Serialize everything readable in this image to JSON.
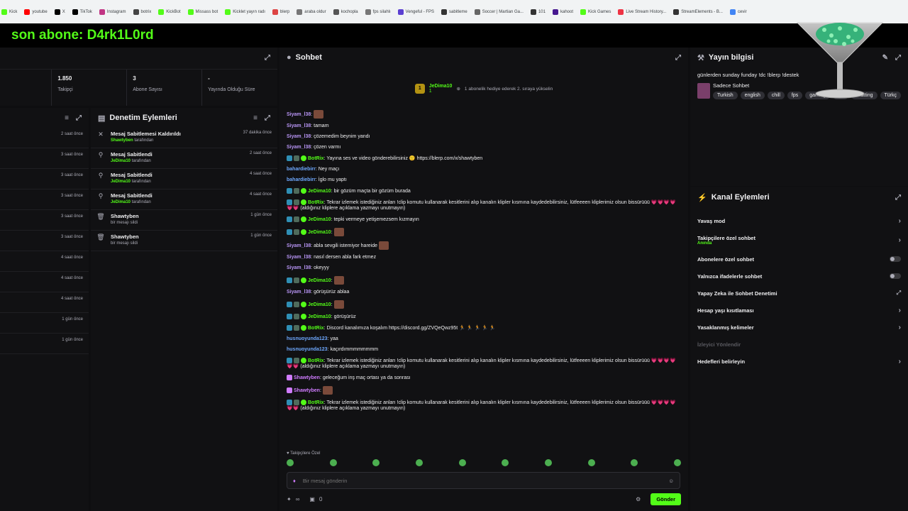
{
  "bookmarks": [
    {
      "label": "Kick",
      "color": "#53fc18"
    },
    {
      "label": "youtube",
      "color": "#ff0000"
    },
    {
      "label": "X",
      "color": "#000000"
    },
    {
      "label": "TikTok",
      "color": "#010101"
    },
    {
      "label": "Instagram",
      "color": "#c13584"
    },
    {
      "label": "botrix",
      "color": "#444444"
    },
    {
      "label": "KickBot",
      "color": "#53fc18"
    },
    {
      "label": "Missass bot",
      "color": "#53fc18"
    },
    {
      "label": "Kicklet yayın radı",
      "color": "#53fc18"
    },
    {
      "label": "blerp",
      "color": "#d44"
    },
    {
      "label": "araba oldur",
      "color": "#777"
    },
    {
      "label": "kochopla",
      "color": "#555"
    },
    {
      "label": "fps silahlı",
      "color": "#777"
    },
    {
      "label": "Vengeful - FPS",
      "color": "#5b3fd1"
    },
    {
      "label": "sabitleme",
      "color": "#333"
    },
    {
      "label": "Soccer | Martian Ga...",
      "color": "#666"
    },
    {
      "label": "101",
      "color": "#333"
    },
    {
      "label": "kahoot",
      "color": "#46178f"
    },
    {
      "label": "Kick Games",
      "color": "#53fc18"
    },
    {
      "label": "Live Stream History...",
      "color": "#e34"
    },
    {
      "label": "StreamElements - B...",
      "color": "#333"
    },
    {
      "label": "cevir",
      "color": "#4285f4"
    }
  ],
  "banner": {
    "text": "son abone: D4rk1L0rd"
  },
  "stats": [
    {
      "value": "1.850",
      "label": "Takipçi"
    },
    {
      "value": "3",
      "label": "Abone Sayısı"
    },
    {
      "value": "-",
      "label": "Yayında Olduğu Süre"
    }
  ],
  "left_times": [
    "2 saat önce",
    "3 saat önce",
    "3 saat önce",
    "3 saat önce",
    "3 saat önce",
    "3 saat önce",
    "4 saat önce",
    "4 saat önce",
    "4 saat önce",
    "1 gün önce",
    "1 gün önce"
  ],
  "modlog": {
    "title": "Denetim Eylemleri",
    "items": [
      {
        "icon": "✕",
        "title": "Mesaj Sabitlemesi Kaldırıldı",
        "by": "Shawtyben",
        "suffix": "tarafından",
        "time": "37 dakika önce"
      },
      {
        "icon": "⚲",
        "title": "Mesaj Sabitlendi",
        "by": "JeDima10",
        "suffix": "tarafından",
        "time": "2 saat önce"
      },
      {
        "icon": "⚲",
        "title": "Mesaj Sabitlendi",
        "by": "JeDima10",
        "suffix": "tarafından",
        "time": "4 saat önce"
      },
      {
        "icon": "⚲",
        "title": "Mesaj Sabitlendi",
        "by": "JeDima10",
        "suffix": "tarafından",
        "time": "4 saat önce"
      },
      {
        "icon": "🗑",
        "title": "Shawtyben",
        "by": "",
        "suffix": "bir mesajı sildi",
        "time": "1 gün önce"
      },
      {
        "icon": "🗑",
        "title": "Shawtyben",
        "by": "",
        "suffix": "bir mesajı sildi",
        "time": "1 gün önce"
      }
    ]
  },
  "chat": {
    "title": "Sohbet",
    "pinned": {
      "badge": "1",
      "name": "JeDima10",
      "count": "1",
      "text": "1 abonelik hediye ederek 2. sıraya yükselin"
    },
    "messages": [
      {
        "user": "Siyam_l38",
        "color": "#b794f4",
        "badges": 0,
        "text": "",
        "emote": true
      },
      {
        "user": "Siyam_l38",
        "color": "#b794f4",
        "badges": 0,
        "text": "tamam"
      },
      {
        "user": "Siyam_l38",
        "color": "#b794f4",
        "badges": 0,
        "text": "çözemedim beynim yandı"
      },
      {
        "user": "Siyam_l38",
        "color": "#b794f4",
        "badges": 0,
        "text": "çözen varmı"
      },
      {
        "user": "BotRix",
        "color": "#53fc18",
        "badges": 2,
        "text": "Yayına ses ve video gönderebilirsiniz 🙂 https://blerp.com/x/shawtyben"
      },
      {
        "user": "bahardiebirr",
        "color": "#6ea8fe",
        "badges": 0,
        "text": "Ney maçı"
      },
      {
        "user": "bahardiebirr",
        "color": "#6ea8fe",
        "badges": 0,
        "text": "İglo mu yaptı"
      },
      {
        "user": "JeDima10",
        "color": "#53fc18",
        "badges": 2,
        "text": "bir gözüm maçta bir gözüm burada"
      },
      {
        "user": "BotRix",
        "color": "#53fc18",
        "badges": 2,
        "text": "Tekrar izlemek istediğiniz anları !clip komutu kullanarak kesitlerini alıp kanalın klipler kısmına kaydedebilirsiniz, lütfeeeen kliplerimiz olsun bissürüüü 💗💗💗💗💗💗 (aldığınız kliplere açıklama yazmayı unutmayın)"
      },
      {
        "user": "JeDima10",
        "color": "#53fc18",
        "badges": 2,
        "text": "tepki vermeye yetişemezsem kızmayın"
      },
      {
        "user": "JeDima10",
        "color": "#53fc18",
        "badges": 2,
        "text": "",
        "emote": true
      },
      {
        "user": "Siyam_l38",
        "color": "#b794f4",
        "badges": 0,
        "text": "abla sevgili istemiyor hareide",
        "emote": true
      },
      {
        "user": "Siyam_l38",
        "color": "#b794f4",
        "badges": 0,
        "text": "nasıl dersen abla fark etmez"
      },
      {
        "user": "Siyam_l38",
        "color": "#b794f4",
        "badges": 0,
        "text": "okeyyy"
      },
      {
        "user": "JeDima10",
        "color": "#53fc18",
        "badges": 2,
        "text": "",
        "emote": true
      },
      {
        "user": "Siyam_l38",
        "color": "#b794f4",
        "badges": 0,
        "text": "görüşürüz ablaa"
      },
      {
        "user": "JeDima10",
        "color": "#53fc18",
        "badges": 2,
        "text": "",
        "emote": true
      },
      {
        "user": "JeDima10",
        "color": "#53fc18",
        "badges": 2,
        "text": "görüşürüz"
      },
      {
        "user": "BotRix",
        "color": "#53fc18",
        "badges": 2,
        "text": "Discord kanalımıza koşalım https://discord.gg/ZVQeQwz95t 🏃 🏃 🏃 🏃 🏃"
      },
      {
        "user": "husnuoyunda123",
        "color": "#6ea8fe",
        "badges": 0,
        "text": "yaa"
      },
      {
        "user": "husnuoyunda123",
        "color": "#6ea8fe",
        "badges": 0,
        "text": "kaçırdımmmmmmmm"
      },
      {
        "user": "BotRix",
        "color": "#53fc18",
        "badges": 2,
        "text": "Tekrar izlemek istediğiniz anları !clip komutu kullanarak kesitlerini alıp kanalın klipler kısmına kaydedebilirsiniz, lütfeeeen kliplerimiz olsun bissürüüü 💗💗💗💗💗💗 (aldığınız kliplere açıklama yazmayı unutmayın)"
      },
      {
        "user": "Shawtyben",
        "color": "#d07cff",
        "badges": 1,
        "text": "geleceğum inş maç ortası ya da sonrası"
      },
      {
        "user": "Shawtyben",
        "color": "#d07cff",
        "badges": 1,
        "text": "",
        "emote": true
      },
      {
        "user": "BotRix",
        "color": "#53fc18",
        "badges": 2,
        "text": "Tekrar izlemek istediğiniz anları !clip komutu kullanarak kesitlerini alıp kanalın klipler kısmına kaydedebilirsiniz, lütfeeeen kliplerimiz olsun bissürüüü 💗💗💗💗💗💗 (aldığınız kliplere açıklama yazmayı unutmayın)"
      }
    ],
    "subtag": "♥ Takipçilere Özel",
    "input_placeholder": "Bir mesaj gönderin",
    "foot_left": "∞",
    "foot_count": "0",
    "send": "Gönder"
  },
  "info": {
    "title": "Yayın bilgisi",
    "stream_title": "günlerden sunday funday !dc !blerp !destek",
    "category": "Sadece Sohbet",
    "tags": [
      "Turkish",
      "english",
      "chill",
      "fps",
      "gaming",
      "fun",
      "chatting",
      "Türkç"
    ]
  },
  "actions": {
    "title": "Kanal Eylemleri",
    "items": [
      {
        "label": "Yavaş mod",
        "kind": "chevron"
      },
      {
        "label": "Takipçilere özel sohbet",
        "sub": "Anında",
        "kind": "chevron"
      },
      {
        "label": "Abonelere özel sohbet",
        "kind": "toggle"
      },
      {
        "label": "Yalnızca ifadelerle sohbet",
        "kind": "toggle"
      },
      {
        "label": "Yapay Zeka ile Sohbet Denetimi",
        "kind": "external"
      },
      {
        "label": "Hesap yaşı kısıtlaması",
        "kind": "chevron"
      },
      {
        "label": "Yasaklanmış kelimeler",
        "kind": "chevron"
      },
      {
        "label": "İzleyici Yönlendir",
        "kind": "disabled"
      },
      {
        "label": "Hedefleri belirleyin",
        "kind": "chevron"
      }
    ]
  }
}
